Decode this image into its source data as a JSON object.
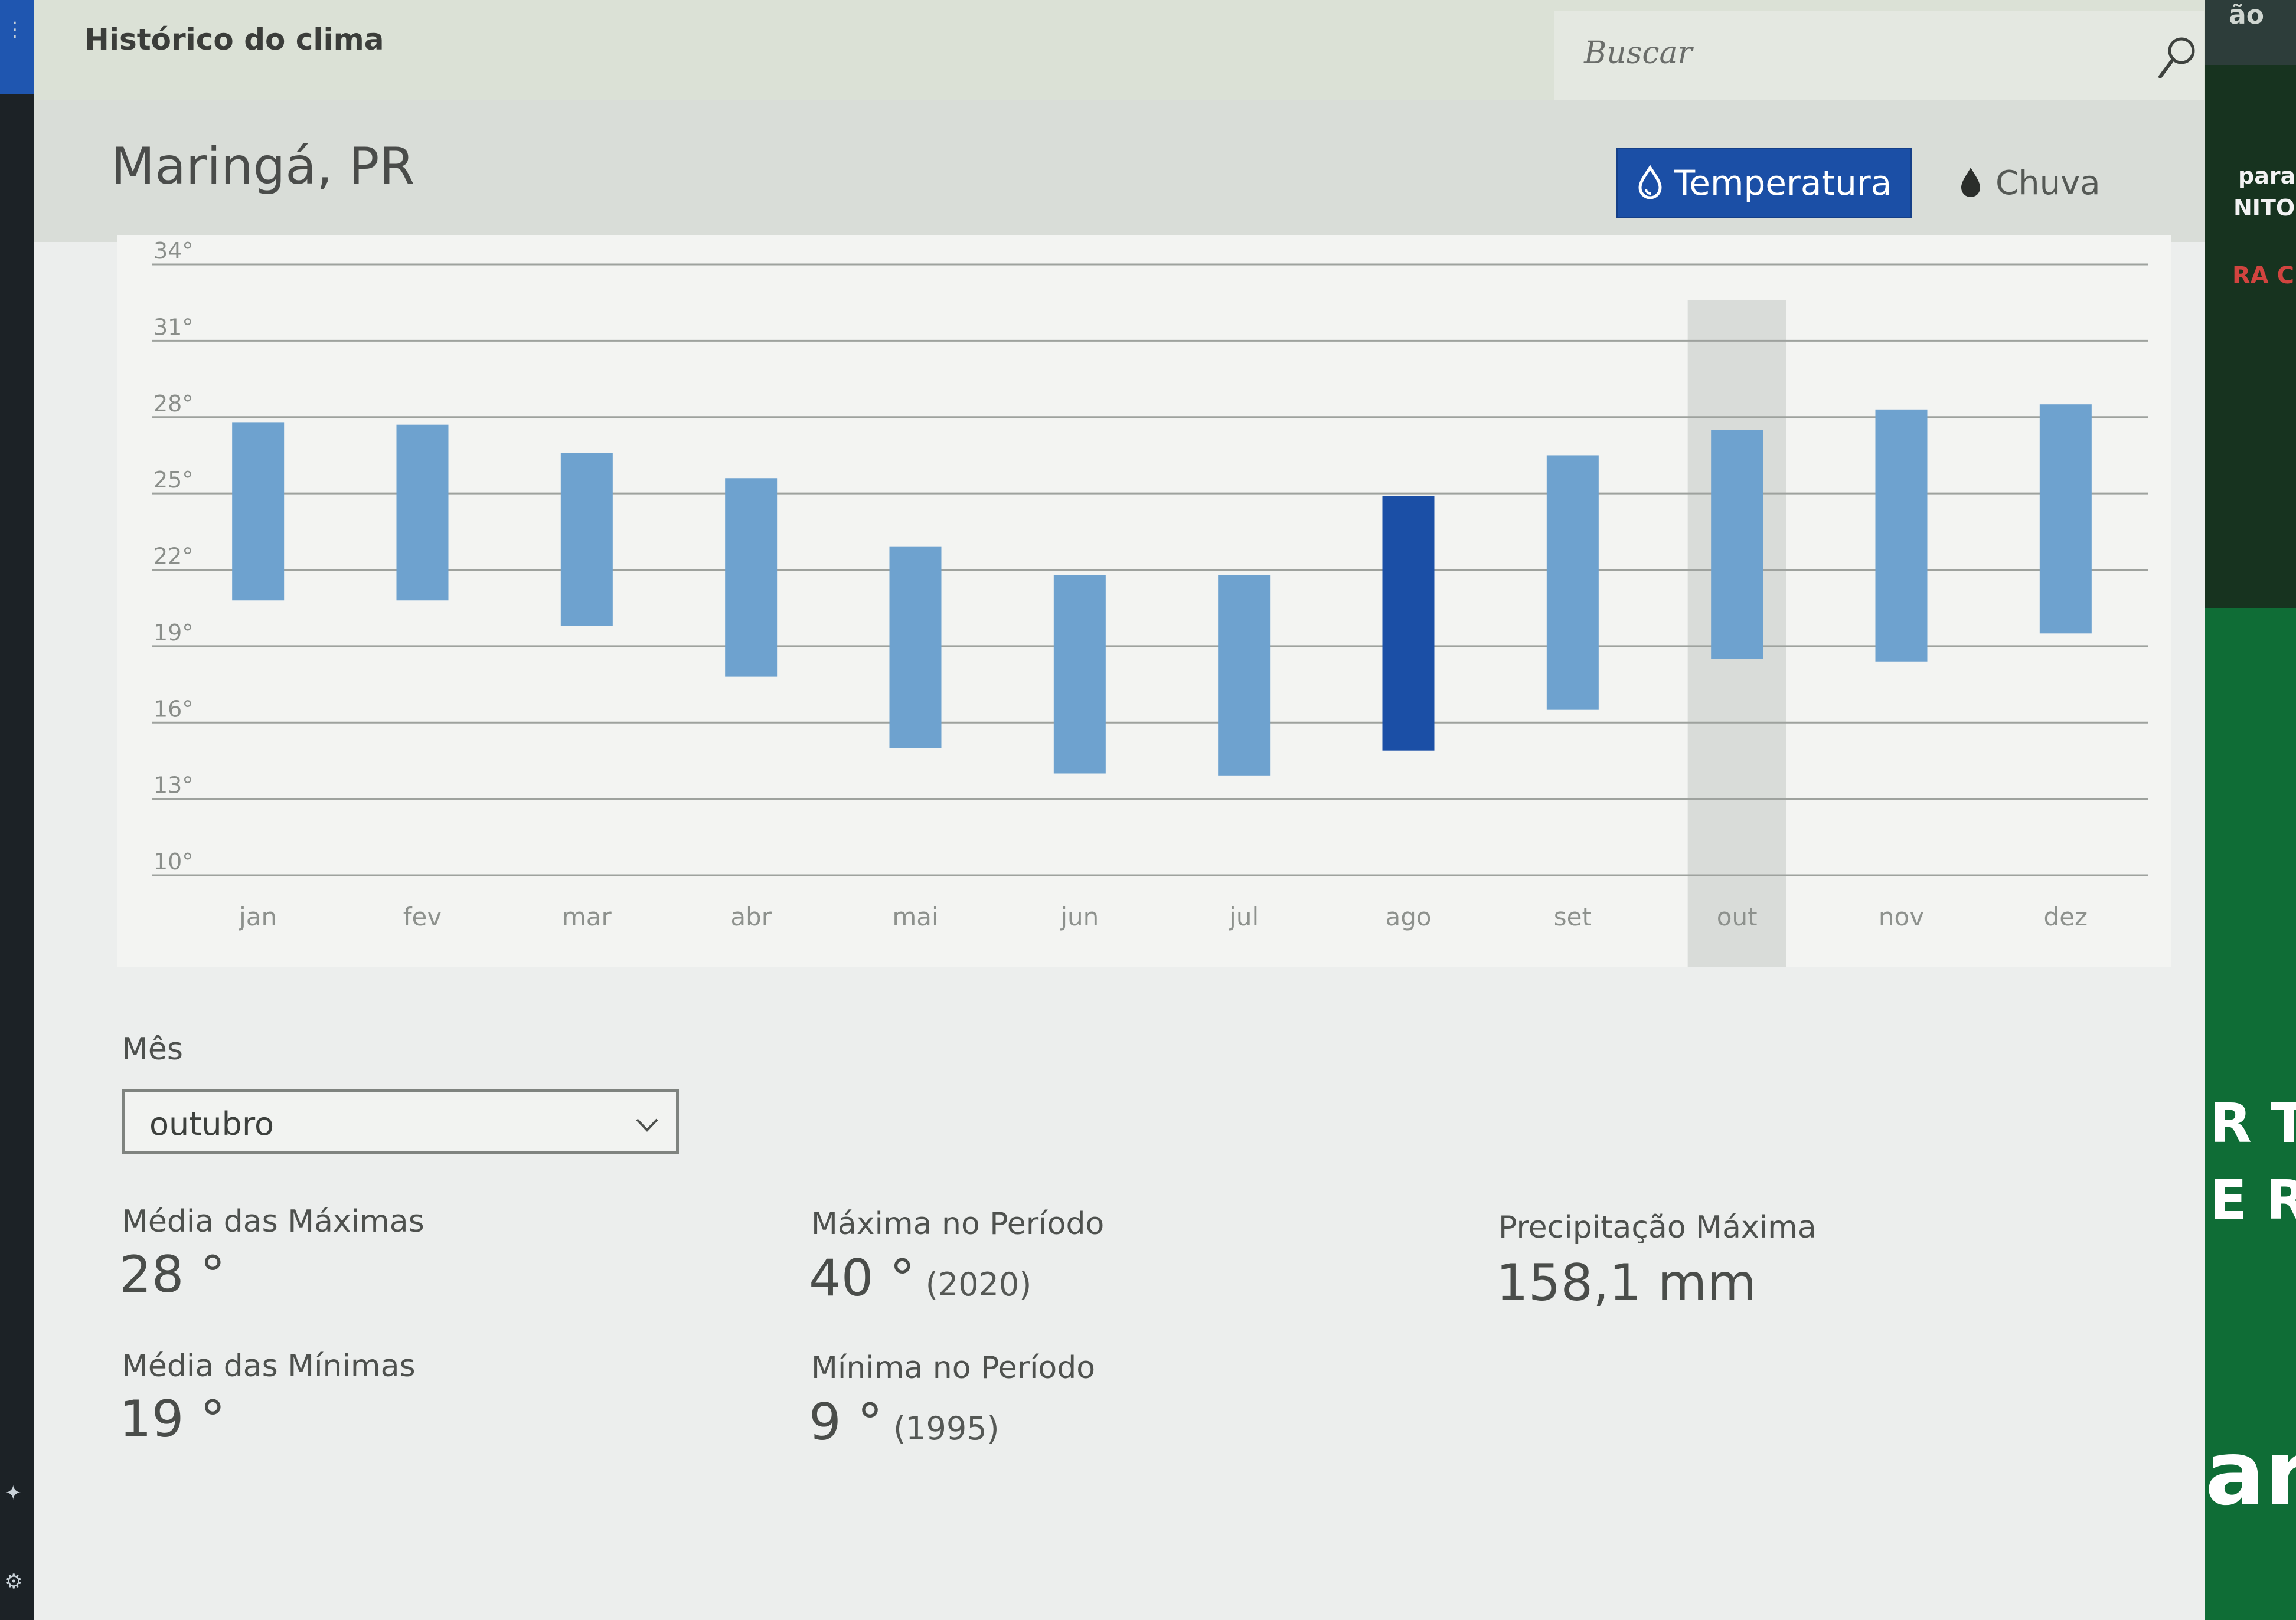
{
  "app": {
    "title": "Histórico do clima",
    "search_placeholder": "Buscar"
  },
  "location": "Maringá, PR",
  "toggles": {
    "temperature_label": "Temperatura",
    "rain_label": "Chuva"
  },
  "colors": {
    "accent": "#1b4fa6",
    "bar": "#6ea2cf",
    "bar_selected": "#1b4fa6"
  },
  "chart_data": {
    "type": "bar",
    "subtype": "floating-range",
    "categories": [
      "jan",
      "fev",
      "mar",
      "abr",
      "mai",
      "jun",
      "jul",
      "ago",
      "set",
      "out",
      "nov",
      "dez"
    ],
    "y_ticks": [
      "34°",
      "31°",
      "28°",
      "25°",
      "22°",
      "19°",
      "16°",
      "13°",
      "10°"
    ],
    "ylim": [
      10,
      34
    ],
    "series": [
      {
        "low": 20.8,
        "high": 27.8
      },
      {
        "low": 20.8,
        "high": 27.7
      },
      {
        "low": 19.8,
        "high": 26.6
      },
      {
        "low": 17.8,
        "high": 25.6
      },
      {
        "low": 15.0,
        "high": 22.9
      },
      {
        "low": 14.0,
        "high": 21.8
      },
      {
        "low": 13.9,
        "high": 21.8
      },
      {
        "low": 14.9,
        "high": 24.9
      },
      {
        "low": 16.5,
        "high": 26.5
      },
      {
        "low": 18.5,
        "high": 27.5
      },
      {
        "low": 18.4,
        "high": 28.3
      },
      {
        "low": 19.5,
        "high": 28.5
      }
    ],
    "highlighted_bar": "ago",
    "selected_column": "out",
    "grid": true
  },
  "month_selector": {
    "label": "Mês",
    "value": "outubro"
  },
  "stats": {
    "avg_max_label": "Média das Máximas",
    "avg_max_value": "28 °",
    "avg_min_label": "Média das Mínimas",
    "avg_min_value": "19 °",
    "period_max_label": "Máxima no Período",
    "period_max_value": "40 °",
    "period_max_year": "(2020)",
    "period_min_label": "Mínima no Período",
    "period_min_value": "9 °",
    "period_min_year": "(1995)",
    "precip_max_label": "Precipitação Máxima",
    "precip_max_value": "158,1 mm"
  },
  "background_text": {
    "right_1": "ão",
    "right_2": "para",
    "right_3": "NITO",
    "right_4": "RA C",
    "right_5": "R T",
    "right_6": "E R",
    "right_7": "ar"
  }
}
